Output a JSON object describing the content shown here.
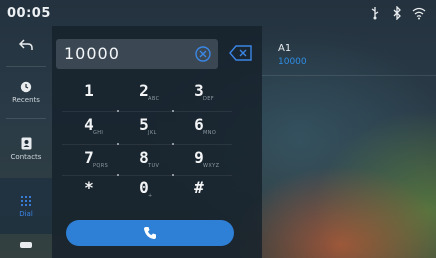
{
  "status_bar": {
    "time": "00:05",
    "icons": [
      "usb-icon",
      "bluetooth-icon",
      "wifi-icon"
    ]
  },
  "sidebar": {
    "items": [
      {
        "id": "back",
        "icon": "back-arrow-icon",
        "label": ""
      },
      {
        "id": "recents",
        "icon": "clock-icon",
        "label": "Recents"
      },
      {
        "id": "contacts",
        "icon": "contacts-book-icon",
        "label": "Contacts"
      },
      {
        "id": "dial",
        "icon": "dialpad-icon",
        "label": "Dial",
        "active": true
      },
      {
        "id": "more",
        "icon": "more-icon",
        "label": ""
      }
    ]
  },
  "dial": {
    "entered_number": "10000",
    "keys": [
      {
        "digit": "1",
        "letters": ""
      },
      {
        "digit": "2",
        "letters": "ABC"
      },
      {
        "digit": "3",
        "letters": "DEF"
      },
      {
        "digit": "4",
        "letters": "GHI"
      },
      {
        "digit": "5",
        "letters": "JKL"
      },
      {
        "digit": "6",
        "letters": "MNO"
      },
      {
        "digit": "7",
        "letters": "PQRS"
      },
      {
        "digit": "8",
        "letters": "TUV"
      },
      {
        "digit": "9",
        "letters": "WXYZ"
      },
      {
        "digit": "*",
        "letters": ""
      },
      {
        "digit": "0",
        "letters": "+"
      },
      {
        "digit": "#",
        "letters": ""
      }
    ]
  },
  "suggestion": {
    "name": "A1",
    "number": "10000"
  },
  "colors": {
    "accent": "#2e7fd6",
    "highlight_text": "#2f8ee6",
    "panel": "#16212b"
  }
}
